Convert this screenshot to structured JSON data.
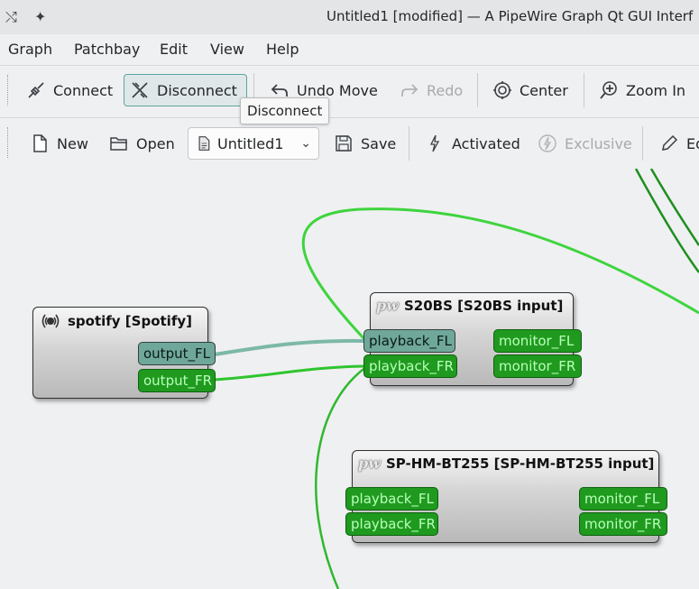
{
  "window": {
    "title": "Untitled1 [modified] — A PipeWire Graph Qt GUI Interf"
  },
  "menu": [
    "Graph",
    "Patchbay",
    "Edit",
    "View",
    "Help"
  ],
  "toolbar1": {
    "connect": "Connect",
    "disconnect": "Disconnect",
    "undo_move": "Undo Move",
    "redo": "Redo",
    "center": "Center",
    "zoom_in": "Zoom In"
  },
  "toolbar2": {
    "new": "New",
    "open": "Open",
    "patchbay_name": "Untitled1",
    "save": "Save",
    "activated": "Activated",
    "exclusive": "Exclusive",
    "edit": "Ed"
  },
  "tooltip": "Disconnect",
  "nodes": {
    "spotify": {
      "title": "spotify [Spotify]",
      "ports": [
        "output_FL",
        "output_FR"
      ]
    },
    "s20bs": {
      "icon": "pw",
      "title": "S20BS [S20BS input]",
      "inputs": [
        "playback_FL",
        "playback_FR"
      ],
      "monitors": [
        "monitor_FL",
        "monitor_FR"
      ]
    },
    "sphm": {
      "icon": "pw",
      "title": "SP-HM-BT255 [SP-HM-BT255 input]",
      "inputs": [
        "playback_FL",
        "playback_FR"
      ],
      "monitors": [
        "monitor_FL",
        "monitor_FR"
      ]
    }
  },
  "colors": {
    "port_green": "#1f9a1f",
    "wire_green": "#2fc52f",
    "selected": "#6fa89a",
    "accent": "#5fa3a3"
  },
  "icons": [
    "app-icon",
    "pin-icon",
    "connect-icon",
    "disconnect-icon",
    "undo-icon",
    "redo-icon",
    "center-icon",
    "zoom-in-icon",
    "new-file-icon",
    "open-folder-icon",
    "save-icon",
    "activated-icon",
    "exclusive-icon",
    "edit-icon",
    "speaker-icon"
  ]
}
